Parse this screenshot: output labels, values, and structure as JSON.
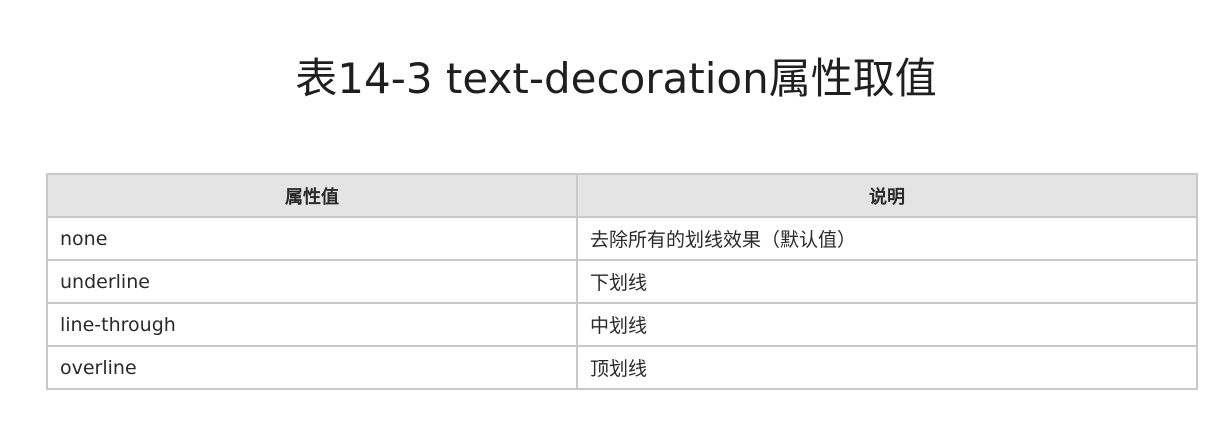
{
  "title": "表14-3 text-decoration属性取值",
  "table": {
    "headers": [
      "属性值",
      "说明"
    ],
    "rows": [
      [
        "none",
        "去除所有的划线效果（默认值）"
      ],
      [
        "underline",
        "下划线"
      ],
      [
        "line-through",
        "中划线"
      ],
      [
        "overline",
        "顶划线"
      ]
    ]
  }
}
